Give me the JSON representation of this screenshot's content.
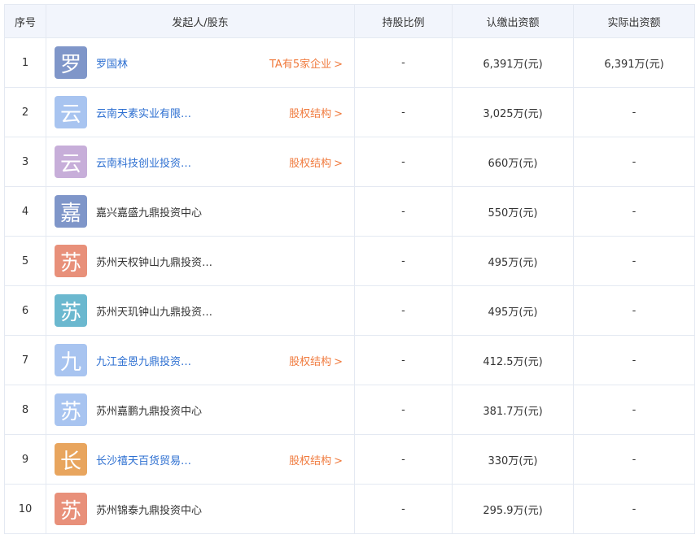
{
  "header": {
    "index": "序号",
    "shareholder": "发起人/股东",
    "ratio": "持股比例",
    "subscribed": "认缴出资额",
    "actual": "实际出资额"
  },
  "chevron": ">",
  "rows": [
    {
      "index": "1",
      "avatar": "罗",
      "avatar_color": "#7f96c9",
      "name": "罗国林",
      "name_link": true,
      "tag": "TA有5家企业",
      "ratio": "-",
      "subscribed": "6,391万(元)",
      "actual": "6,391万(元)"
    },
    {
      "index": "2",
      "avatar": "云",
      "avatar_color": "#a8c4f0",
      "name": "云南天素实业有限公司",
      "name_link": true,
      "tag": "股权结构",
      "ratio": "-",
      "subscribed": "3,025万(元)",
      "actual": "-"
    },
    {
      "index": "3",
      "avatar": "云",
      "avatar_color": "#c7aed9",
      "name": "云南科技创业投资有...",
      "name_link": true,
      "tag": "股权结构",
      "ratio": "-",
      "subscribed": "660万(元)",
      "actual": "-"
    },
    {
      "index": "4",
      "avatar": "嘉",
      "avatar_color": "#7f96c9",
      "name": "嘉兴嘉盛九鼎投资中心",
      "name_link": false,
      "tag": "",
      "ratio": "-",
      "subscribed": "550万(元)",
      "actual": "-"
    },
    {
      "index": "5",
      "avatar": "苏",
      "avatar_color": "#e8907a",
      "name": "苏州天权钟山九鼎投资中心",
      "name_link": false,
      "tag": "",
      "ratio": "-",
      "subscribed": "495万(元)",
      "actual": "-"
    },
    {
      "index": "6",
      "avatar": "苏",
      "avatar_color": "#6bb8cf",
      "name": "苏州天玑钟山九鼎投资中心",
      "name_link": false,
      "tag": "",
      "ratio": "-",
      "subscribed": "495万(元)",
      "actual": "-"
    },
    {
      "index": "7",
      "avatar": "九",
      "avatar_color": "#a8c4f0",
      "name": "九江金恩九鼎投资中心",
      "name_link": true,
      "tag": "股权结构",
      "ratio": "-",
      "subscribed": "412.5万(元)",
      "actual": "-"
    },
    {
      "index": "8",
      "avatar": "苏",
      "avatar_color": "#a8c4f0",
      "name": "苏州嘉鹏九鼎投资中心",
      "name_link": false,
      "tag": "",
      "ratio": "-",
      "subscribed": "381.7万(元)",
      "actual": "-"
    },
    {
      "index": "9",
      "avatar": "长",
      "avatar_color": "#e8a55e",
      "name": "长沙禧天百货贸易有...",
      "name_link": true,
      "tag": "股权结构",
      "ratio": "-",
      "subscribed": "330万(元)",
      "actual": "-"
    },
    {
      "index": "10",
      "avatar": "苏",
      "avatar_color": "#e8907a",
      "name": "苏州锦泰九鼎投资中心",
      "name_link": false,
      "tag": "",
      "ratio": "-",
      "subscribed": "295.9万(元)",
      "actual": "-"
    }
  ]
}
